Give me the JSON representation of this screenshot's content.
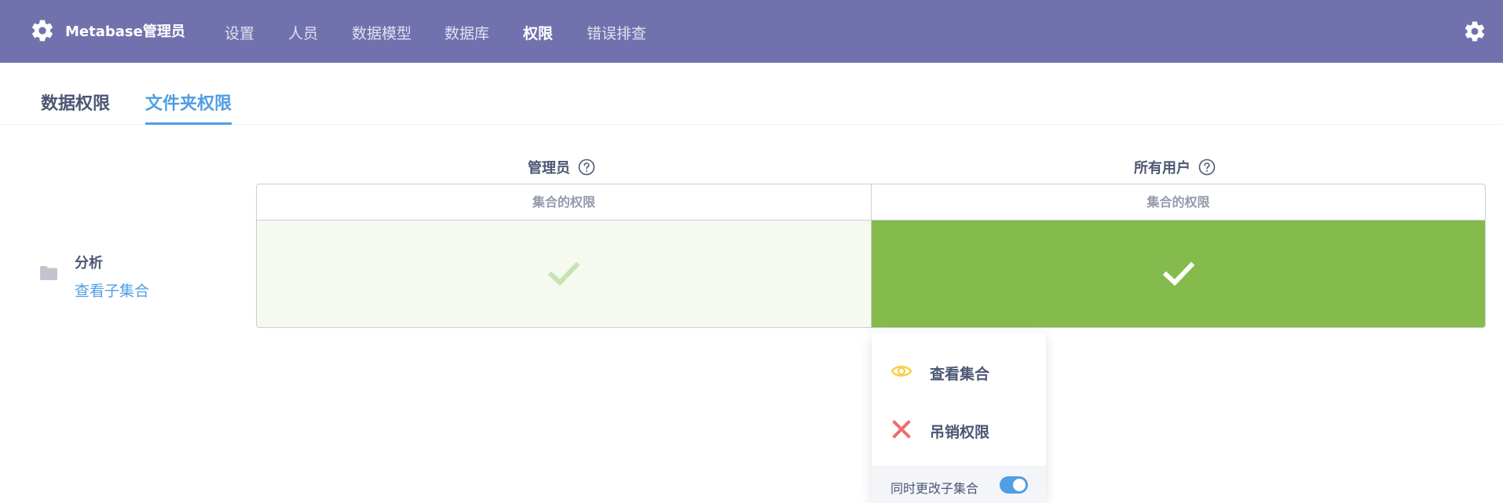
{
  "topbar": {
    "brand": "Metabase管理员",
    "nav": [
      {
        "label": "设置",
        "active": false
      },
      {
        "label": "人员",
        "active": false
      },
      {
        "label": "数据模型",
        "active": false
      },
      {
        "label": "数据库",
        "active": false
      },
      {
        "label": "权限",
        "active": true
      },
      {
        "label": "错误排查",
        "active": false
      }
    ],
    "color": "#7172ad"
  },
  "tabs": [
    {
      "label": "数据权限",
      "active": false
    },
    {
      "label": "文件夹权限",
      "active": true
    }
  ],
  "groups": [
    {
      "name": "管理员"
    },
    {
      "name": "所有用户"
    }
  ],
  "grid": {
    "column_header": "集合的权限",
    "rows": [
      {
        "title": "分析",
        "link": "查看子集合",
        "cells": [
          "curate",
          "curate"
        ]
      }
    ]
  },
  "popover": {
    "options": [
      {
        "label": "查看集合",
        "icon": "eye-icon",
        "color": "#f9cf48"
      },
      {
        "label": "吊销权限",
        "icon": "close-icon",
        "color": "#ed6e6e"
      }
    ],
    "footer_label": "同时更改子集合",
    "toggle_on": true
  },
  "colors": {
    "accent": "#509ee3",
    "grant": "#84bb4c",
    "grant_light": "#f5f9f0"
  }
}
